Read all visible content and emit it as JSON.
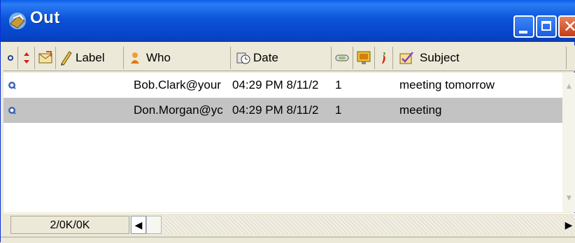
{
  "window": {
    "title": "Out",
    "buttons": {
      "minimize": "minimize",
      "maximize": "maximize",
      "close": "close"
    }
  },
  "columns": {
    "label": "Label",
    "who": "Who",
    "date": "Date",
    "subject": "Subject"
  },
  "rows": [
    {
      "who": "Bob.Clark@your",
      "date": "04:29 PM 8/11/2",
      "count": "1",
      "subject": "meeting tomorrow",
      "selected": false
    },
    {
      "who": "Don.Morgan@yc",
      "date": "04:29 PM 8/11/2",
      "count": "1",
      "subject": "meeting",
      "selected": true
    }
  ],
  "status": {
    "text": "2/0K/0K"
  },
  "colors": {
    "titlebar": "#0B53D8",
    "selection": "#C3C3C3",
    "status_icon": "#3A64B4"
  },
  "icons": [
    "mailbox-icon",
    "status-dot-icon",
    "priority-arrows-icon",
    "forward-envelope-icon",
    "label-pencil-icon",
    "who-person-icon",
    "date-clock-icon",
    "attachment-icon",
    "monitor-icon",
    "pepper-icon",
    "subject-check-icon",
    "sent-status-icon"
  ]
}
